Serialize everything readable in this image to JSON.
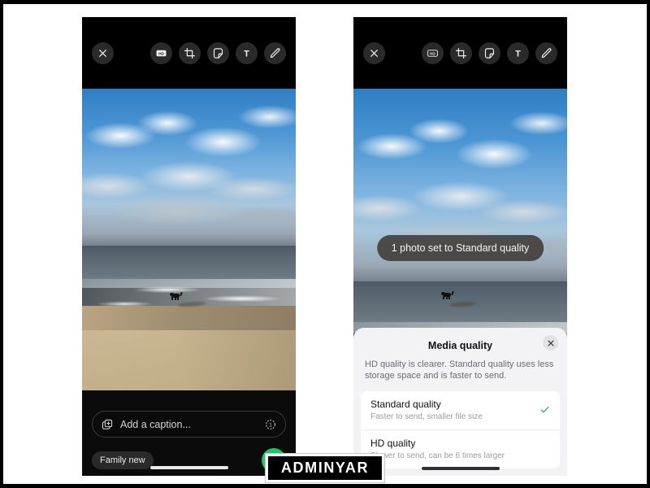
{
  "watermark": {
    "text": "ADMINYAR"
  },
  "phone_left": {
    "toolbar": {
      "close_label": "Close",
      "items": [
        {
          "name": "hd-quality-icon",
          "label": "HD"
        },
        {
          "name": "crop-icon",
          "label": "Crop"
        },
        {
          "name": "sticker-icon",
          "label": "Sticker"
        },
        {
          "name": "text-icon",
          "label": "T"
        },
        {
          "name": "draw-icon",
          "label": "Draw"
        }
      ]
    },
    "photo": {
      "alt": "Black dog on a sandy beach with ocean waves and cloudy blue sky"
    },
    "caption": {
      "placeholder": "Add a caption...",
      "add_photo_icon": "add-photo-icon",
      "view_once_icon": "view-once-icon"
    },
    "recipient_chip": "Family new",
    "send_button_label": "Send"
  },
  "phone_right": {
    "toolbar": {
      "close_label": "Close",
      "items": [
        {
          "name": "hd-quality-icon",
          "label": "HD"
        },
        {
          "name": "crop-icon",
          "label": "Crop"
        },
        {
          "name": "sticker-icon",
          "label": "Sticker"
        },
        {
          "name": "text-icon",
          "label": "T"
        },
        {
          "name": "draw-icon",
          "label": "Draw"
        }
      ]
    },
    "toast": "1 photo set to Standard quality",
    "sheet": {
      "title": "Media quality",
      "close_label": "Close",
      "description": "HD quality is clearer. Standard quality uses less storage space and is faster to send.",
      "options": [
        {
          "title": "Standard quality",
          "subtitle": "Faster to send, smaller file size",
          "selected": true
        },
        {
          "title": "HD quality",
          "subtitle": "Slower to send, can be 6 times larger",
          "selected": false
        }
      ]
    }
  },
  "colors": {
    "send_green": "#21c063",
    "check_green": "#25a35a",
    "sheet_bg": "#f3f3f6",
    "card_bg": "#ffffff",
    "phone_bg": "#000000",
    "page_bg": "#ffffff"
  }
}
